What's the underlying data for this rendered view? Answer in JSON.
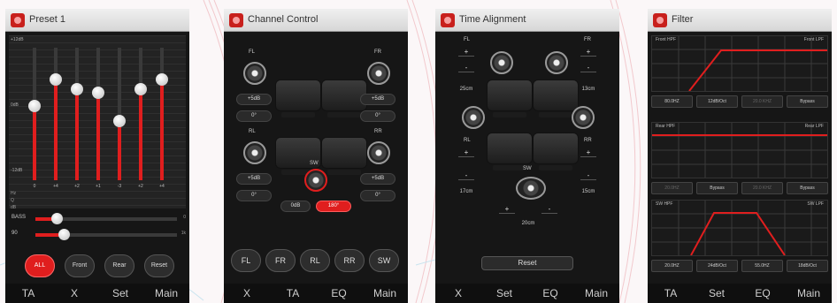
{
  "colors": {
    "accent": "#e01e1e",
    "panel_bg": "#161616",
    "titlebar": "#e4e4e4"
  },
  "eq": {
    "title": "Preset 1",
    "scale_top": "+12dB",
    "scale_mid": "0dB",
    "scale_bottom": "-12dB",
    "bands": [
      {
        "gain": "0",
        "level": 0.56
      },
      {
        "gain": "+4",
        "level": 0.76
      },
      {
        "gain": "+2",
        "level": 0.69
      },
      {
        "gain": "+1",
        "level": 0.66
      },
      {
        "gain": "-3",
        "level": 0.45
      },
      {
        "gain": "+2",
        "level": 0.69
      },
      {
        "gain": "+4",
        "level": 0.76
      }
    ],
    "row_labels": [
      "Hz",
      "Q",
      "dB"
    ],
    "bass_label": "BASS",
    "bass_value": "0",
    "bass_level": 0.15,
    "second_label": "90",
    "second_value": "1k",
    "second_level": 0.2,
    "buttons": [
      "ALL",
      "Front",
      "Rear",
      "Reset"
    ],
    "nav": [
      "TA",
      "X",
      "Set",
      "Main"
    ]
  },
  "channel": {
    "title": "Channel Control",
    "labels": {
      "fl": "FL",
      "fr": "FR",
      "rl": "RL",
      "rr": "RR",
      "sw": "SW"
    },
    "gain_fl": "+5dB",
    "gain_fr": "+5dB",
    "gain_rl": "+5dB",
    "gain_rr": "+5dB",
    "phase_fl": "0°",
    "phase_fr": "0°",
    "phase_rl": "0°",
    "phase_rr": "0°",
    "sw_gain": "0dB",
    "sw_phase": "180°",
    "buttons": [
      "FL",
      "FR",
      "RL",
      "RR",
      "SW"
    ],
    "nav": [
      "X",
      "TA",
      "EQ",
      "Main"
    ]
  },
  "time": {
    "title": "Time Alignment",
    "labels": {
      "fl": "FL",
      "fr": "FR",
      "rl": "RL",
      "rr": "RR",
      "sw": "SW"
    },
    "plus": "+",
    "minus": "-",
    "fl": "25cm",
    "fr": "13cm",
    "rl": "17cm",
    "rr": "15cm",
    "sw": "20cm",
    "reset": "Reset",
    "nav": [
      "X",
      "Set",
      "EQ",
      "Main"
    ]
  },
  "filter": {
    "title": "Filter",
    "g1": {
      "left": "Front HPF",
      "right": "Front LPF"
    },
    "g2": {
      "left": "Rear HPF",
      "right": "Rear LPF"
    },
    "g3": {
      "left": "SW HPF",
      "right": "SW LPF"
    },
    "row1": [
      "80.0HZ",
      "12dB/Oct",
      "20.0 KHZ",
      "Bypass"
    ],
    "row2": [
      "20.0HZ",
      "Bypass",
      "20.0 KHZ",
      "Bypass"
    ],
    "row3": [
      "20.0HZ",
      "24dB/Oct",
      "55.0HZ",
      "18dB/Oct"
    ],
    "nav": [
      "TA",
      "Set",
      "EQ",
      "Main"
    ]
  }
}
